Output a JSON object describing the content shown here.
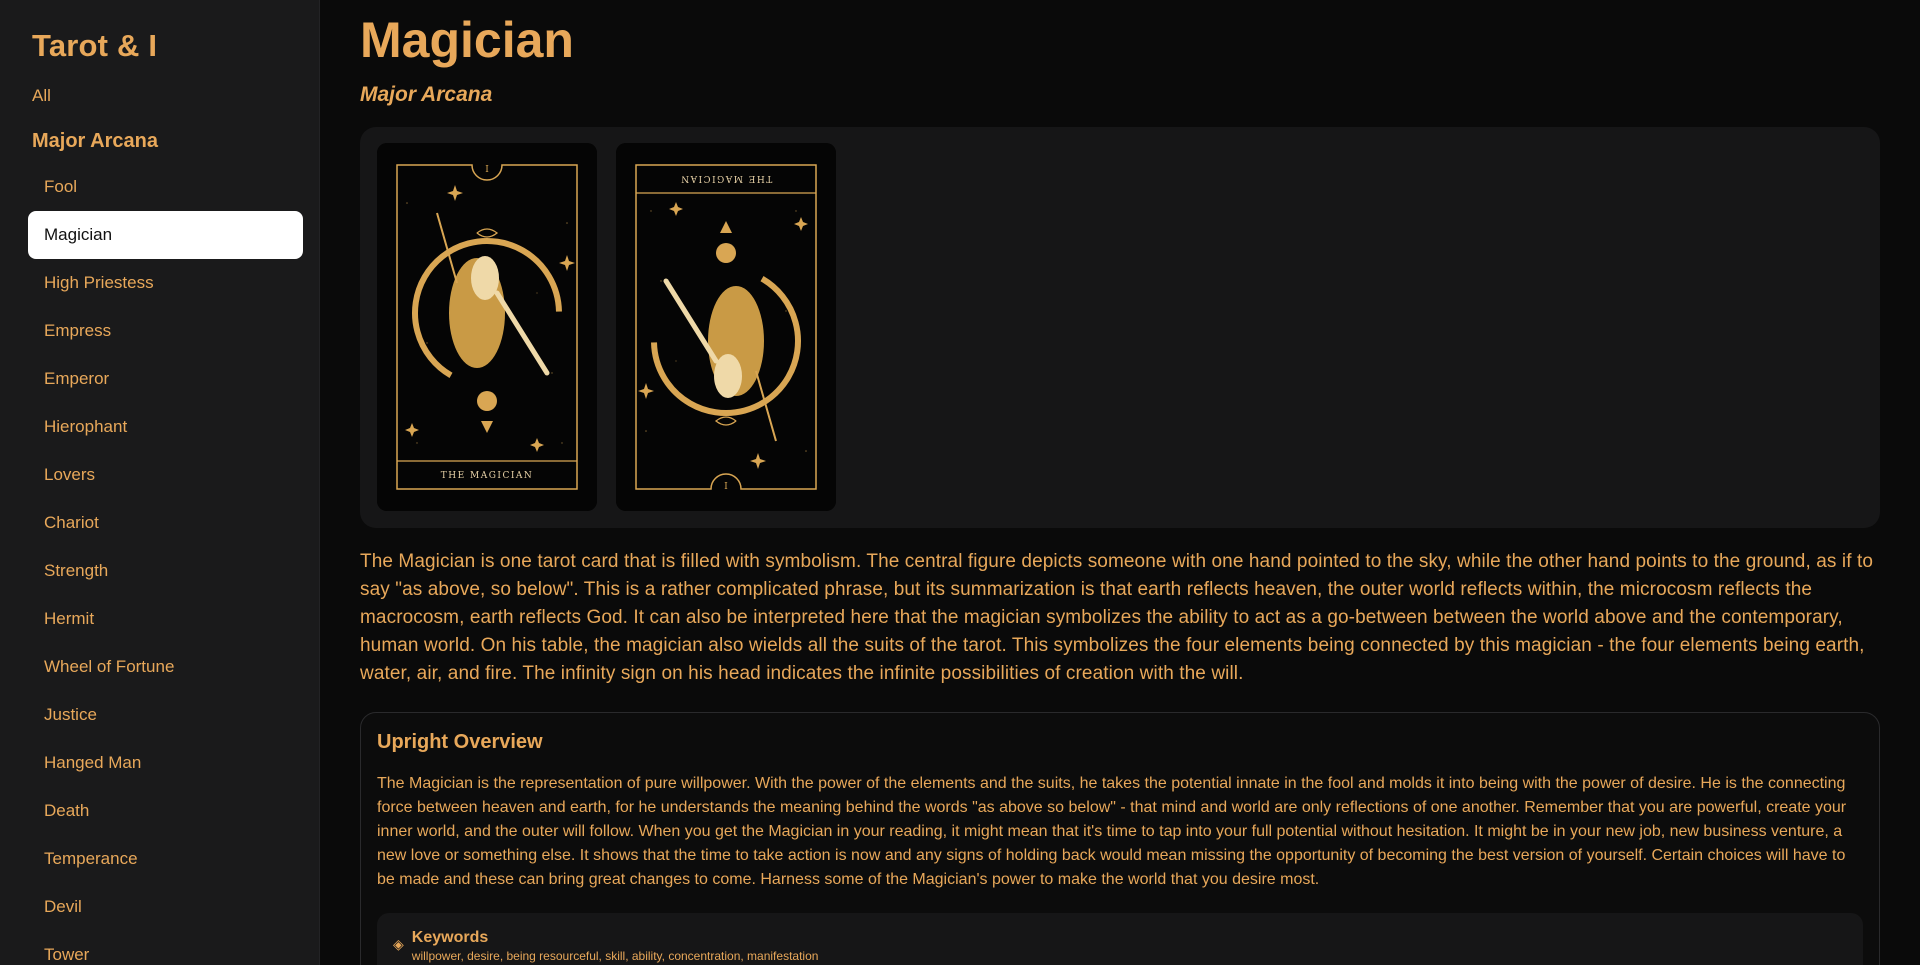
{
  "sidebar": {
    "brand": "Tarot & I",
    "all_label": "All",
    "section_heading": "Major Arcana",
    "items": [
      {
        "label": "Fool"
      },
      {
        "label": "Magician"
      },
      {
        "label": "High Priestess"
      },
      {
        "label": "Empress"
      },
      {
        "label": "Emperor"
      },
      {
        "label": "Hierophant"
      },
      {
        "label": "Lovers"
      },
      {
        "label": "Chariot"
      },
      {
        "label": "Strength"
      },
      {
        "label": "Hermit"
      },
      {
        "label": "Wheel of Fortune"
      },
      {
        "label": "Justice"
      },
      {
        "label": "Hanged Man"
      },
      {
        "label": "Death"
      },
      {
        "label": "Temperance"
      },
      {
        "label": "Devil"
      },
      {
        "label": "Tower"
      }
    ],
    "active_item": "Magician"
  },
  "main": {
    "title": "Magician",
    "subtitle": "Major Arcana",
    "cards": [
      {
        "numeral": "I",
        "name": "THE MAGICIAN",
        "orientation": "upright"
      },
      {
        "numeral": "I",
        "name": "THE MAGICIAN",
        "orientation": "reversed"
      }
    ],
    "description": "The Magician is one tarot card that is filled with symbolism. The central figure depicts someone with one hand pointed to the sky, while the other hand points to the ground, as if to say \"as above, so below\". This is a rather complicated phrase, but its summarization is that earth reflects heaven, the outer world reflects within, the microcosm reflects the macrocosm, earth reflects God. It can also be interpreted here that the magician symbolizes the ability to act as a go-between between the world above and the contemporary, human world. On his table, the magician also wields all the suits of the tarot. This symbolizes the four elements being connected by this magician - the four elements being earth, water, air, and fire. The infinity sign on his head indicates the infinite possibilities of creation with the will.",
    "upright": {
      "title": "Upright Overview",
      "text": "The Magician is the representation of pure willpower. With the power of the elements and the suits, he takes the potential innate in the fool and molds it into being with the power of desire. He is the connecting force between heaven and earth, for he understands the meaning behind the words \"as above so below\" - that mind and world are only reflections of one another. Remember that you are powerful, create your inner world, and the outer will follow. When you get the Magician in your reading, it might mean that it's time to tap into your full potential without hesitation. It might be in your new job, new business venture, a new love or something else. It shows that the time to take action is now and any signs of holding back would mean missing the opportunity of becoming the best version of yourself. Certain choices will have to be made and these can bring great changes to come. Harness some of the Magician's power to make the world that you desire most.",
      "keywords_title": "Keywords",
      "keywords_icon": "sparkle-icon",
      "keywords": "willpower, desire, being resourceful, skill, ability, concentration, manifestation"
    }
  },
  "colors": {
    "accent": "#e8a85a",
    "background": "#0a0a0a",
    "sidebar_bg": "#1a1a1b",
    "panel_bg": "#161617",
    "card_gold": "#d9a653",
    "active_bg": "#ffffff"
  }
}
